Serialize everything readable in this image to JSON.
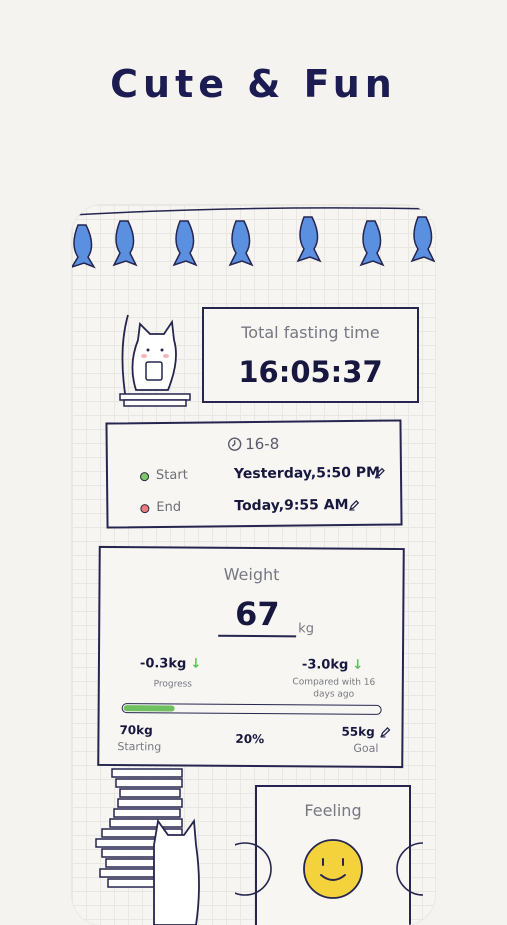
{
  "headline": "Cute & Fun",
  "fasting": {
    "title": "Total fasting time",
    "time": "16:05:37"
  },
  "schedule": {
    "plan": "16-8",
    "start_label": "Start",
    "start_value": "Yesterday,5:50 PM",
    "end_label": "End",
    "end_value": "Today,9:55 AM"
  },
  "weight": {
    "title": "Weight",
    "value": "67",
    "unit": "kg",
    "progress_value": "-0.3kg",
    "progress_label": "Progress",
    "compare_value": "-3.0kg",
    "compare_label": "Compared with 16 days ago",
    "progress_fraction": 0.2,
    "percent": "20%",
    "starting_value": "70kg",
    "starting_label": "Starting",
    "goal_value": "55kg",
    "goal_label": "Goal"
  },
  "feeling": {
    "title": "Feeling"
  },
  "colors": {
    "accent": "#25254f",
    "progress": "#6fc060",
    "fish": "#5b8fe0",
    "smiley": "#f4d23c"
  }
}
